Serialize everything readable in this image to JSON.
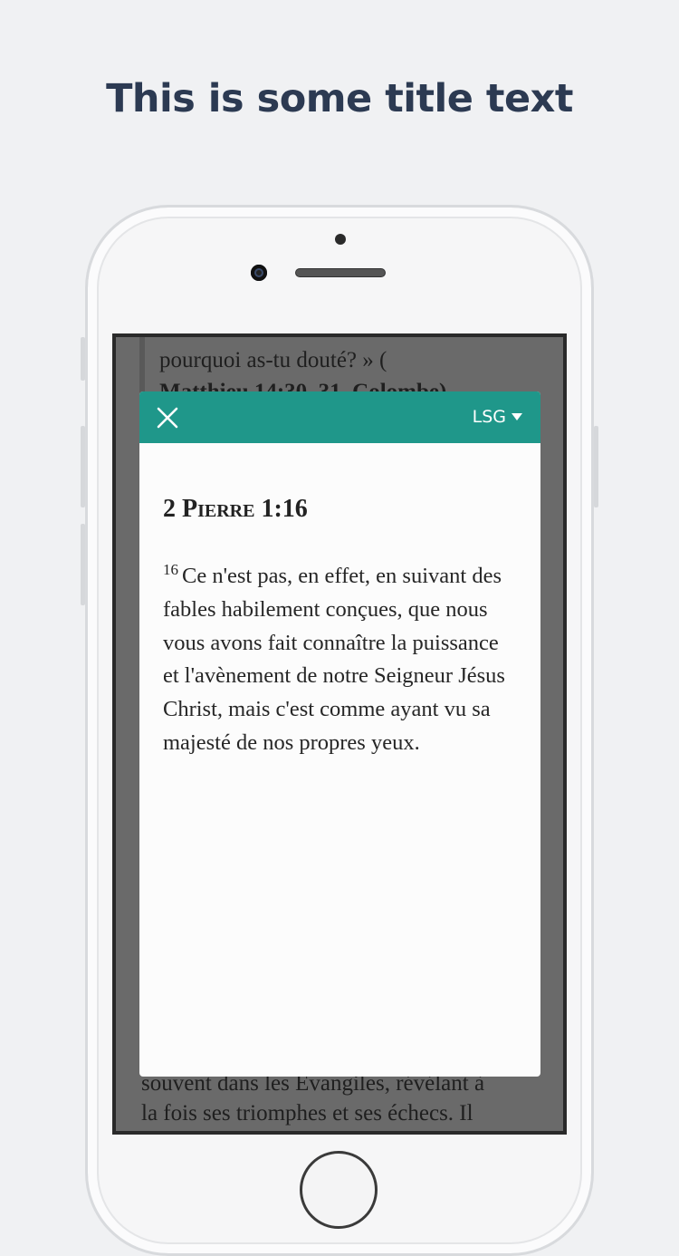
{
  "promo": {
    "title": "This is some title text"
  },
  "background": {
    "top_line1": "pourquoi as-tu douté? » (",
    "top_line2": "Matthieu 14:30, 31, Colombe).",
    "bottom_line1": "souvent dans les Évangiles, révélant à",
    "bottom_line2": "la fois ses triomphes et ses échecs. Il"
  },
  "modal": {
    "close_icon": "close-icon",
    "version_label": "LSG",
    "reference": "2 Pierre 1:16",
    "verse_number": "16",
    "verse_text": "Ce n'est pas, en effet, en suivant des fables habilement conçues, que nous vous avons fait connaître la puissance et l'avènement de notre Seigneur Jésus Christ, mais c'est comme ayant vu sa majesté de nos propres yeux."
  },
  "colors": {
    "header": "#1f978a",
    "title": "#2c3a52",
    "overlay": "#6a6a6a"
  }
}
